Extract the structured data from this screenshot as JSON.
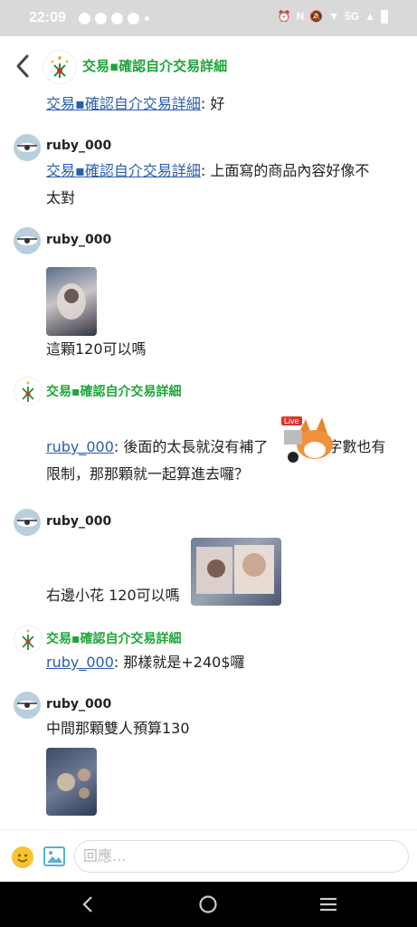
{
  "status": {
    "time": "22:09",
    "network": "5G"
  },
  "header": {
    "title": "交易▪確認自介交易詳細"
  },
  "messages": [
    {
      "link": "交易▪確認自介交易詳細",
      "text": ": 好"
    },
    {
      "name": "ruby_000",
      "link": "交易▪確認自介交易詳細",
      "text": ": 上面寫的商品內容好像不",
      "text2": "太對"
    },
    {
      "name": "ruby_000",
      "text": "這顆120可以嗎"
    },
    {
      "name": "交易▪確認自介交易詳細",
      "link": "ruby_000",
      "text": ": 後面的太長就沒有補了",
      "text_after": "字數也有",
      "text2": "限制，那那顆就一起算進去囉？",
      "sticker_badge": "Live"
    },
    {
      "name": "ruby_000",
      "text": "右邊小花 120可以嗎"
    },
    {
      "name": "交易▪確認自介交易詳細",
      "link": "ruby_000",
      "text": ": 那樣就是+240$囉"
    },
    {
      "name": "ruby_000",
      "text": "中間那顆雙人預算130"
    }
  ],
  "composer": {
    "placeholder": "回應..."
  },
  "colors": {
    "accent_green": "#1ea53a",
    "link_blue": "#2a5db0"
  }
}
